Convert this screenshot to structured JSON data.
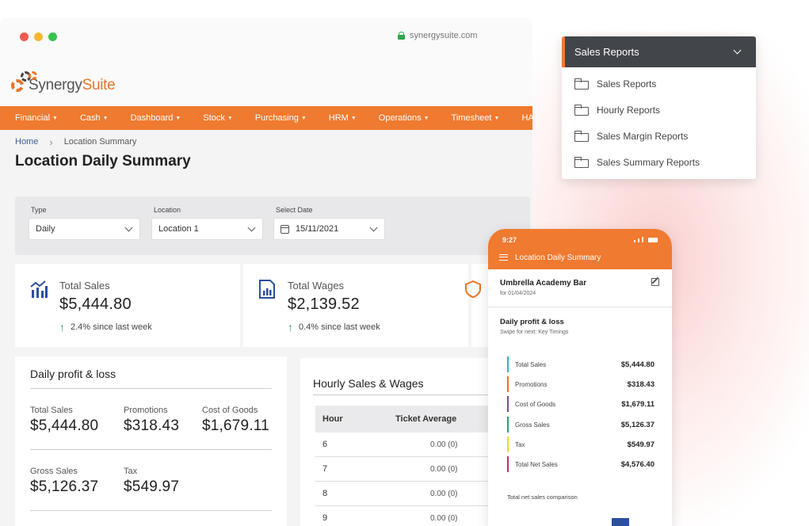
{
  "browser": {
    "url": "synergysuite.com",
    "brand_part1": "Synergy",
    "brand_part2": "Suite",
    "nav": [
      "Financial",
      "Cash",
      "Dashboard",
      "Stock",
      "Purchasing",
      "HRM",
      "Operations",
      "Timesheet",
      "HACC"
    ],
    "breadcrumb": {
      "home": "Home",
      "current": "Location Summary"
    },
    "page_title": "Location Daily Summary",
    "filters": {
      "type": {
        "label": "Type",
        "value": "Daily"
      },
      "location": {
        "label": "Location",
        "value": "Location 1"
      },
      "date": {
        "label": "Select Date",
        "value": "15/11/2021"
      }
    },
    "stats": [
      {
        "label": "Total Sales",
        "value": "$5,444.80",
        "change": "2.4% since last week",
        "icon": "chart-icon"
      },
      {
        "label": "Total Wages",
        "value": "$2,139.52",
        "change": "0.4% since last week",
        "icon": "report-icon"
      }
    ],
    "profit_loss": {
      "title": "Daily profit & loss",
      "items": [
        {
          "label": "Total Sales",
          "value": "$5,444.80"
        },
        {
          "label": "Promotions",
          "value": "$318.43"
        },
        {
          "label": "Cost of Goods",
          "value": "$1,679.11"
        },
        {
          "label": "Gross Sales",
          "value": "$5,126.37"
        },
        {
          "label": "Tax",
          "value": "$549.97"
        }
      ]
    },
    "hourly": {
      "title": "Hourly Sales & Wages",
      "headers": [
        "Hour",
        "Ticket Average"
      ],
      "rows": [
        {
          "hour": "6",
          "ticket": "0.00 (0)"
        },
        {
          "hour": "7",
          "ticket": "0.00 (0)"
        },
        {
          "hour": "8",
          "ticket": "0.00 (0)"
        },
        {
          "hour": "9",
          "ticket": "0.00 (0)"
        }
      ]
    }
  },
  "dropdown": {
    "selected": "Sales Reports",
    "options": [
      "Sales Reports",
      "Hourly Reports",
      "Sales Margin Reports",
      "Sales Summary Reports"
    ]
  },
  "phone": {
    "time": "9:27",
    "title": "Location Daily Summary",
    "venue": "Umbrella Academy Bar",
    "date": "for 01/04/2024",
    "section": "Daily profit & loss",
    "swipe": "Swipe for next: Key Timings",
    "rows": [
      {
        "label": "Total Sales",
        "value": "$5,444.80",
        "color": "#3ab0c8"
      },
      {
        "label": "Promotions",
        "value": "$318.43",
        "color": "#e8742a"
      },
      {
        "label": "Cost of Goods",
        "value": "$1,679.11",
        "color": "#7a4fa0"
      },
      {
        "label": "Gross Sales",
        "value": "$5,126.37",
        "color": "#2aa36b"
      },
      {
        "label": "Tax",
        "value": "$549.97",
        "color": "#f2d23a"
      },
      {
        "label": "Total Net Sales",
        "value": "$4,576.40",
        "color": "#c0306a"
      }
    ],
    "comparison": "Total net sales comparison"
  },
  "colors": {
    "accent": "#ef7a30",
    "dark": "#424549",
    "chart_blue": "#2c4f9e"
  }
}
